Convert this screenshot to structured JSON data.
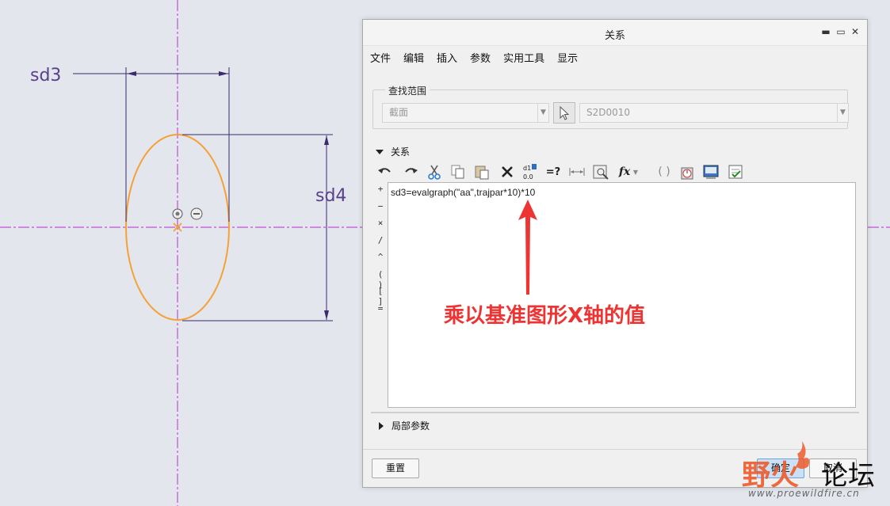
{
  "sketch": {
    "dim_horizontal": "sd3",
    "dim_vertical": "sd4"
  },
  "dialog": {
    "title": "关系",
    "window_buttons": {
      "minimize": "▬",
      "maximize": "▭",
      "close": "✕"
    },
    "menu": [
      "文件",
      "编辑",
      "插入",
      "参数",
      "实用工具",
      "显示"
    ],
    "scope": {
      "legend": "查找范围",
      "type_value": "截面",
      "object_value": "S2D0010"
    },
    "relations_header": "关系",
    "toolbar_icons": [
      "undo-icon",
      "redo-icon",
      "cut-icon",
      "copy-icon",
      "paste-icon",
      "delete-icon",
      "switch-display-icon",
      "evaluate-icon",
      "insert-dimension-icon",
      "show-units-icon",
      "insert-function-icon",
      "insert-parameter-icon",
      "sort-icon",
      "execute-icon",
      "verify-icon"
    ],
    "toolbar_glyphs": {
      "evaluate": "=?",
      "function": "fx"
    },
    "operators": [
      "+",
      "−",
      "×",
      "/",
      "^",
      "( )",
      "[ ]",
      "="
    ],
    "editor_text": "sd3=evalgraph(\"aa\",trajpar*10)*10",
    "local_params_header": "局部参数",
    "buttons": {
      "reset": "重置",
      "ok": "确定",
      "cancel": "取消"
    }
  },
  "annotation": {
    "text": "乘以基准图形X轴的值",
    "color": "#ee3333"
  },
  "watermark": {
    "part1": "野火",
    "part2": "论坛",
    "url": "www.proewildfire.cn"
  },
  "colors": {
    "ellipse": "#f4a236",
    "centerline": "#c24fd6",
    "dimension": "#3a2b6e"
  }
}
